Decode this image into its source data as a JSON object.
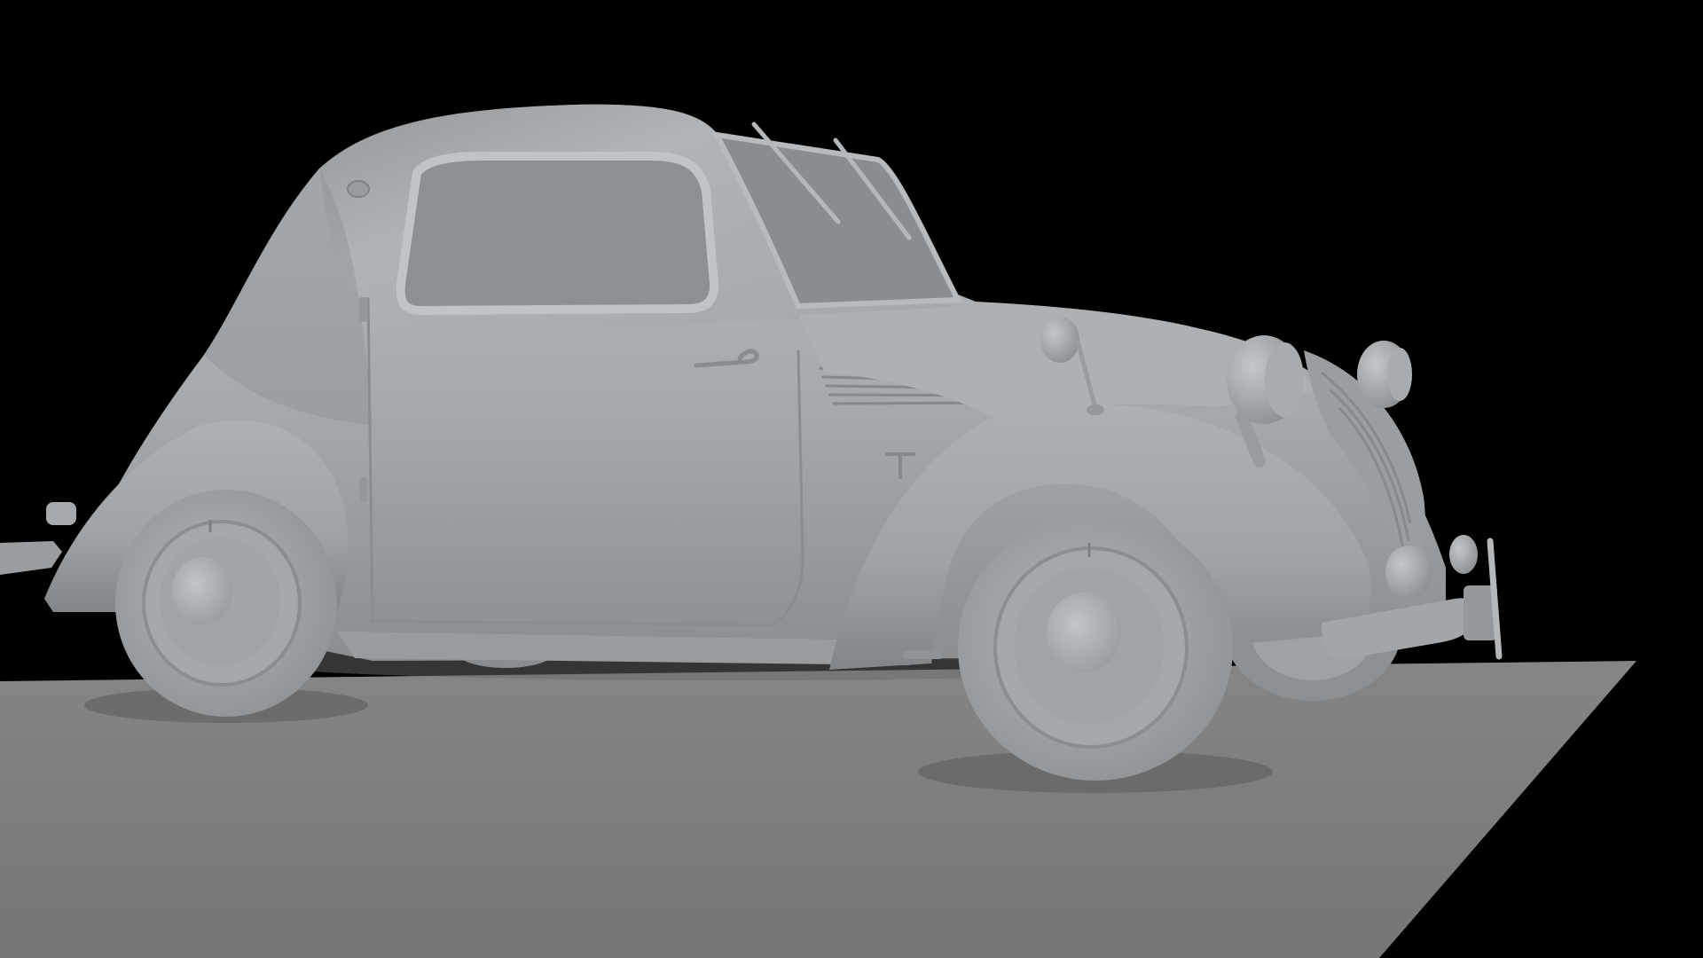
{
  "scene": {
    "subject": "clay-render-vintage-coupe",
    "colors": {
      "background": "#000000",
      "ground": "#7d7d7d",
      "body": "#a9acae",
      "body_shadow": "#7e8183",
      "glass": "#8f9294",
      "tire": "#9ea1a3",
      "hub": "#b3b6b8"
    }
  }
}
